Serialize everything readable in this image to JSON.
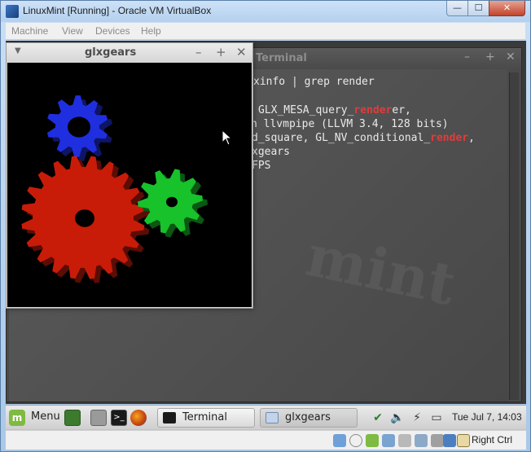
{
  "window": {
    "title": "LinuxMint [Running] - Oracle VM VirtualBox",
    "min_glyph": "—",
    "max_glyph": "☐",
    "close_glyph": "✕"
  },
  "vbox_menu": [
    {
      "label": "Machine"
    },
    {
      "label": "View"
    },
    {
      "label": "Devices"
    },
    {
      "label": "Help"
    }
  ],
  "terminal": {
    "title": "Terminal",
    "lines": [
      {
        "pre": "xinfo | grep render",
        "hl": "",
        "post": ""
      },
      {
        "pre": "",
        "hl": "",
        "post": ""
      },
      {
        "pre": "GLX_MESA_query_",
        "hl": "render",
        "post": "er,"
      },
      {
        "pre": "n llvmpipe (LLVM 3.4, 128 bits)",
        "hl": "",
        "post": ""
      },
      {
        "pre": "d_square, GL_NV_conditional_",
        "hl": "render",
        "post": ","
      },
      {
        "pre": "xgears",
        "hl": "",
        "post": ""
      },
      {
        "pre": "FPS",
        "hl": "",
        "post": ""
      }
    ],
    "highlight_color": "#e23b3b"
  },
  "glxgears": {
    "title": "glxgears",
    "gears": [
      {
        "color": "#1f2fe0",
        "name": "blue-gear"
      },
      {
        "color": "#c81c08",
        "name": "red-gear"
      },
      {
        "color": "#18c22a",
        "name": "green-gear"
      }
    ]
  },
  "taskbar": {
    "menu_label": "Menu",
    "tasks": [
      {
        "label": "Terminal",
        "active": false
      },
      {
        "label": "glxgears",
        "active": true
      }
    ],
    "clock": "Tue Jul  7, 14:03"
  },
  "statusbar": {
    "host_key": "Right Ctrl"
  }
}
